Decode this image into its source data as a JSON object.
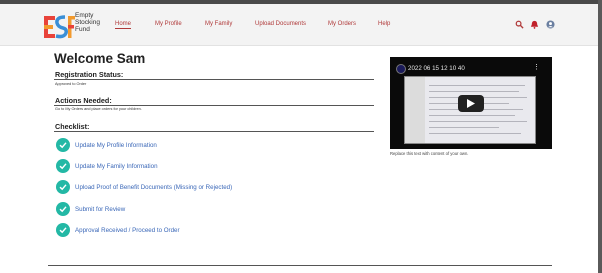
{
  "brand": {
    "logo_text": [
      "Empty",
      "Stocking",
      "Fund"
    ],
    "colors": {
      "red": "#e8433a",
      "orange": "#f29a2e",
      "blue": "#3a8fd6",
      "teal": "#23b8a5"
    }
  },
  "nav": {
    "items": [
      {
        "label": "Home",
        "active": true
      },
      {
        "label": "My Profile"
      },
      {
        "label": "My Family"
      },
      {
        "label": "Upload Documents"
      },
      {
        "label": "My Orders"
      },
      {
        "label": "Help"
      }
    ],
    "icons": [
      "search-icon",
      "bell-icon",
      "account-icon"
    ]
  },
  "main": {
    "welcome": "Welcome Sam",
    "registration_label": "Registration Status:",
    "registration_value": "Approved to Order",
    "actions_label": "Actions Needed:",
    "actions_value": "Go to My Orders and place orders for your children.",
    "checklist_label": "Checklist:",
    "checklist": [
      "Update My Profile Information",
      "Update My Family Information",
      "Upload Proof of Benefit Documents (Missing or Rejected)",
      "Submit for Review",
      "Approval Received / Proceed to Order"
    ]
  },
  "video": {
    "title": "2022 06 15 12 10 40",
    "caption": "Replace this text with content of your own."
  }
}
